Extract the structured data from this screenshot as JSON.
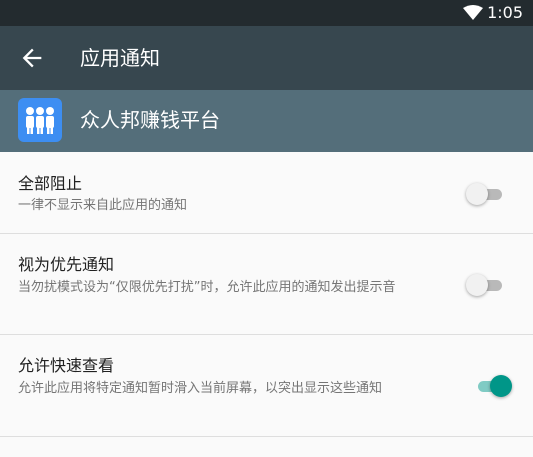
{
  "status_bar": {
    "time": "1:05",
    "wifi_icon": "wifi-icon"
  },
  "toolbar": {
    "title": "应用通知",
    "back_icon": "arrow-back-icon"
  },
  "app": {
    "name": "众人邦赚钱平台",
    "icon": "people-app-icon",
    "icon_color": "#3d8ef2"
  },
  "settings": [
    {
      "title": "全部阻止",
      "subtitle": "一律不显示来自此应用的通知",
      "enabled": false
    },
    {
      "title": "视为优先通知",
      "subtitle": "当勿扰模式设为“仅限优先打扰”时，允许此应用的通知发出提示音",
      "enabled": false
    },
    {
      "title": "允许快速查看",
      "subtitle": "允许此应用将特定通知暂时滑入当前屏幕，以突出显示这些通知",
      "enabled": true
    }
  ],
  "colors": {
    "accent": "#009688",
    "toolbar": "#37474f",
    "status_bar": "#232b2f",
    "app_header": "#546e7a"
  }
}
